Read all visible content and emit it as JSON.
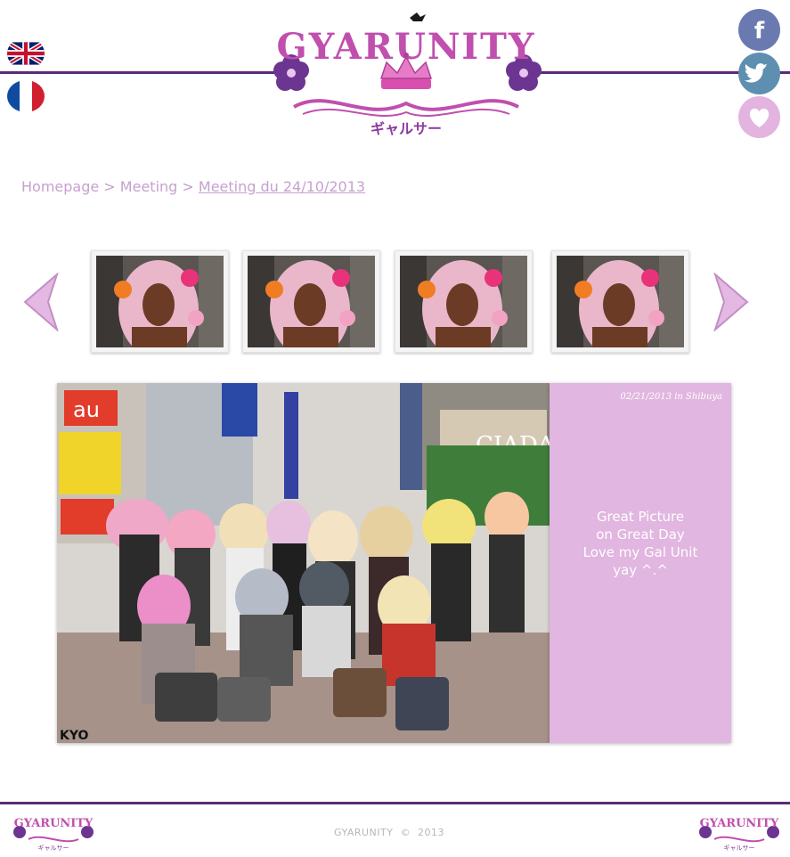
{
  "header": {
    "logo_text": "GYARUNITY",
    "logo_subtext": "ギャルサー"
  },
  "languages": [
    {
      "name": "English",
      "icon": "uk-flag-icon"
    },
    {
      "name": "Français",
      "icon": "france-flag-icon"
    }
  ],
  "social": {
    "facebook_icon": "facebook-icon",
    "twitter_icon": "twitter-icon",
    "favorite_icon": "heart-icon"
  },
  "breadcrumb": {
    "home": "Homepage",
    "sep1": " > ",
    "section": "Meeting",
    "sep2": " > ",
    "current": "Meeting du 24/10/2013"
  },
  "carousel": {
    "prev_icon": "chevron-left-icon",
    "next_icon": "chevron-right-icon",
    "thumbnails": 4
  },
  "photo": {
    "watermark": "KYO",
    "shop_sign": "CIADA",
    "sign_au": "au"
  },
  "caption": {
    "date_line": "02/21/2013 in Shibuya",
    "line1": "Great Picture",
    "line2": "on Great Day",
    "line3": "Love my Gal Unit",
    "line4": "yay ^.^"
  },
  "footer": {
    "copyright": "GYARUNITY  ©  2013"
  },
  "colors": {
    "accent_purple": "#5a2a78",
    "logo_pink": "#c04fae",
    "caption_bg": "#e1b6e0",
    "breadcrumb": "#c7a1cf"
  }
}
